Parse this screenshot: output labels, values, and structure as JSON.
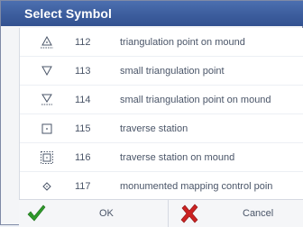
{
  "dialog": {
    "title": "Select Symbol"
  },
  "symbols": [
    {
      "icon": "triangulation-point-on-mound-icon",
      "code": "112",
      "description": "triangulation point on mound"
    },
    {
      "icon": "small-triangulation-point-icon",
      "code": "113",
      "description": "small triangulation point"
    },
    {
      "icon": "small-triangulation-point-on-mound-icon",
      "code": "114",
      "description": "small triangulation point on mound"
    },
    {
      "icon": "traverse-station-icon",
      "code": "115",
      "description": "traverse station"
    },
    {
      "icon": "traverse-station-on-mound-icon",
      "code": "116",
      "description": "traverse station on mound"
    },
    {
      "icon": "monumented-mapping-control-point-icon",
      "code": "117",
      "description": "monumented mapping control poin"
    }
  ],
  "buttons": {
    "ok_label": "OK",
    "ok_icon": "green-checkmark-icon",
    "cancel_label": "Cancel",
    "cancel_icon": "red-x-icon"
  },
  "colors": {
    "titlebar": "#3c5d9d",
    "ok_icon": "#2e9a2a",
    "cancel_icon": "#cc2222"
  }
}
